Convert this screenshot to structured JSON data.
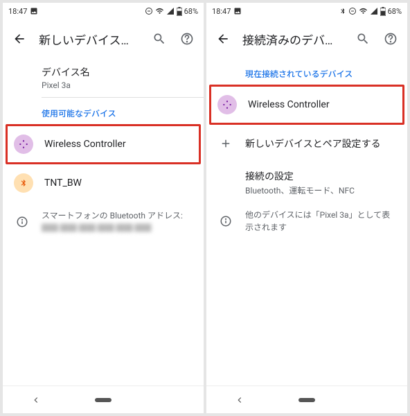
{
  "status": {
    "time": "18:47",
    "battery": "68%"
  },
  "left": {
    "title": "新しいデバイスとペア...",
    "deviceNameLabel": "デバイス名",
    "deviceName": "Pixel 3a",
    "availableLabel": "使用可能なデバイス",
    "devices": [
      {
        "name": "Wireless Controller"
      },
      {
        "name": "TNT_BW"
      }
    ],
    "footerPrefix": "スマートフォンの Bluetooth アドレス: ",
    "footerBlur": "██:██:██:██:██:██"
  },
  "right": {
    "title": "接続済みのデバイス",
    "connectedLabel": "現在接続されているデバイス",
    "connectedDevice": "Wireless Controller",
    "pairNew": "新しいデバイスとペア設定する",
    "prefsTitle": "接続の設定",
    "prefsSub": "Bluetooth、運転モード、NFC",
    "visibility": "他のデバイスには「Pixel 3a」として表示されます"
  }
}
